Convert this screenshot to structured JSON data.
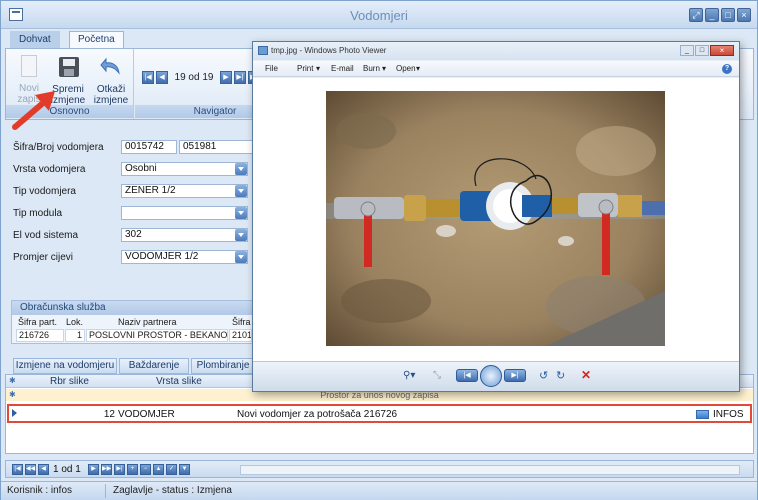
{
  "window": {
    "title": "Vodomjeri"
  },
  "ribbon": {
    "tabs": [
      "Dohvat",
      "Početna"
    ],
    "buttons": {
      "novi": "Novi zapis",
      "spremi_line1": "Spremi",
      "spremi_line2": "izmjene",
      "otkazi_line1": "Otkaži",
      "otkazi_line2": "izmjene"
    },
    "groups": {
      "osnovno": "Osnovno",
      "navigator": "Navigator"
    },
    "navigator_counter": "19 od 19"
  },
  "form": {
    "sifra_broj_label": "Šifra/Broj vodomjera",
    "sifra_value": "0015742",
    "broj_value": "051981",
    "vrsta_label": "Vrsta vodomjera",
    "vrsta_value": "Osobni",
    "tip_label": "Tip vodomjera",
    "tip_value": "ZENER 1/2",
    "tip_modula_label": "Tip modula",
    "tip_modula_value": "",
    "el_vod_label": "El vod sistema",
    "el_vod_value": "302",
    "promjer_label": "Promjer cijevi",
    "promjer_value": "VODOMJER 1/2"
  },
  "obracunska": {
    "title": "Obračunska služba",
    "headers": [
      "Šifra part.",
      "Lok.",
      "Naziv partnera",
      "Šifra"
    ],
    "row": [
      "216726",
      "1",
      "POSLOVNI PROSTOR - BEKANOVIĆ H",
      "2101"
    ]
  },
  "lower_tabs": [
    "Izmjene na vodomjeru",
    "Baždarenje",
    "Plombiranje"
  ],
  "grid": {
    "headers": [
      "Rbr slike",
      "Vrsta slike"
    ],
    "new_row_text": "Prostor za unos novog zapisa",
    "row": {
      "rbr": "12",
      "vrsta": "VODOMJER",
      "opis": "Novi vodomjer za potrošača 216726",
      "tag": "INFOS"
    }
  },
  "bottom_nav": {
    "counter": "1 od 1"
  },
  "status": {
    "user": "Korisnik : infos",
    "state": "Zaglavlje - status : Izmjena"
  },
  "photo_viewer": {
    "title": "tmp.jpg - Windows Photo Viewer",
    "menu": [
      "File",
      "Print",
      "E-mail",
      "Burn",
      "Open"
    ]
  },
  "colors": {
    "accent": "#4e78b0",
    "highlight": "#e04a3a"
  }
}
